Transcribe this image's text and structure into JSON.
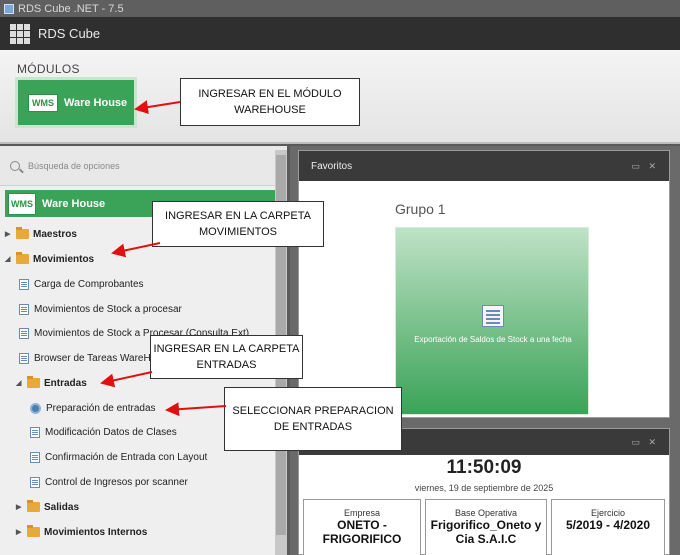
{
  "window": {
    "title": "RDS Cube .NET - 7.5"
  },
  "app": {
    "name": "RDS Cube"
  },
  "modulos": {
    "title": "MÓDULOS",
    "tile": {
      "badge": "WMS",
      "label": "Ware House"
    }
  },
  "sidebar": {
    "search_placeholder": "Búsqueda de opciones",
    "header": {
      "badge": "WMS",
      "label": "Ware House"
    },
    "items": [
      {
        "label": "Maestros",
        "type": "folder"
      },
      {
        "label": "Movimientos",
        "type": "folder"
      },
      {
        "label": "Carga de Comprobantes",
        "type": "doc"
      },
      {
        "label": "Movimientos de Stock a procesar",
        "type": "doc"
      },
      {
        "label": "Movimientos de Stock a Procesar (Consulta Ext)",
        "type": "doc"
      },
      {
        "label": "Browser de Tareas WareHouse",
        "type": "doc"
      },
      {
        "label": "Entradas",
        "type": "folder"
      },
      {
        "label": "Preparación de entradas",
        "type": "doc"
      },
      {
        "label": "Modificación Datos de Clases",
        "type": "doc"
      },
      {
        "label": "Confirmación de Entrada con Layout",
        "type": "doc"
      },
      {
        "label": "Control de Ingresos por scanner",
        "type": "doc"
      },
      {
        "label": "Salidas",
        "type": "folder"
      },
      {
        "label": "Movimientos Internos",
        "type": "folder"
      }
    ]
  },
  "favoritos": {
    "title": "Favoritos",
    "group": "Grupo 1",
    "tile_label": "Exportación de Saldos de Stock a una fecha"
  },
  "status": {
    "time": "11:50:09",
    "date": "viernes, 19 de septiembre de 2025",
    "empresa_label": "Empresa",
    "empresa_value": "ONETO - FRIGORIFICO",
    "base_label": "Base Operativa",
    "base_value": "Frigorifico_Oneto y Cia S.A.I.C",
    "ejercicio_label": "Ejercicio",
    "ejercicio_value": "5/2019 - 4/2020"
  },
  "callouts": {
    "c1": "INGRESAR EN EL MÓDULO WAREHOUSE",
    "c2": "INGRESAR EN LA CARPETA MOVIMIENTOS",
    "c3": "INGRESAR EN LA CARPETA ENTRADAS",
    "c4": "SELECCIONAR PREPARACION DE ENTRADAS"
  },
  "colors": {
    "accent_green": "#3aa357",
    "arrow_red": "#e01010"
  },
  "icons": [
    "rds-cube-icon",
    "search-icon",
    "folder-icon",
    "document-icon",
    "wms-badge-icon"
  ]
}
